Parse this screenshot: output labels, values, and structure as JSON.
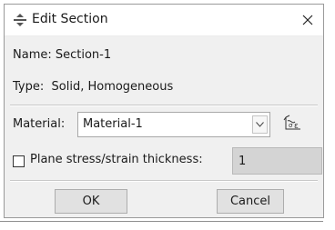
{
  "window": {
    "title": "Edit Section",
    "app_icon": "abaqus-section-icon",
    "close_icon": "close-x-icon"
  },
  "info": {
    "name_label": "Name:",
    "name_value": "Section-1",
    "type_label": "Type:",
    "type_value": "Solid, Homogeneous"
  },
  "material": {
    "label": "Material:",
    "selected": "Material-1",
    "dropdown_icon": "chevron-down-icon",
    "manager_icon": "material-manager-icon"
  },
  "thickness": {
    "checked": false,
    "label": "Plane stress/strain thickness:",
    "value": "1"
  },
  "buttons": {
    "ok": "OK",
    "cancel": "Cancel"
  }
}
